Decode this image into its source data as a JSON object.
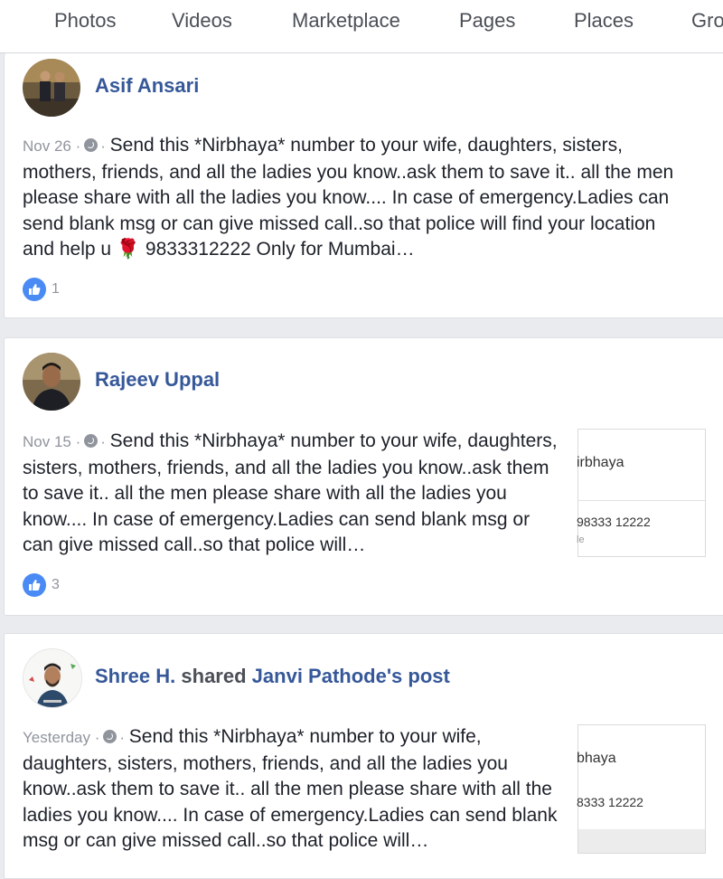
{
  "nav": {
    "tabs": [
      "Photos",
      "Videos",
      "Marketplace",
      "Pages",
      "Places",
      "Gro"
    ]
  },
  "posts": [
    {
      "author": "Asif Ansari",
      "date": "Nov 26",
      "text": "Send this *Nirbhaya* number to your wife, daughters, sisters, mothers, friends, and all the ladies you know..ask them to save it.. all the men please share with all the ladies you know.... In case of emergency.Ladies can send blank msg or can give missed call..so that police will find your location and help u 🌹 9833312222 Only for Mumbai…",
      "likes": "1"
    },
    {
      "author": "Rajeev Uppal",
      "date": "Nov 15",
      "text": "Send this *Nirbhaya* number to your wife, daughters, sisters, mothers, friends, and all the ladies you know..ask them to save it.. all the men please share with all the ladies you know.... In case of emergency.Ladies can send blank msg or can give missed call..so that police will…",
      "likes": "3",
      "thumb": {
        "line1": "irbhaya",
        "line2": "98333 12222",
        "line3": "le"
      }
    },
    {
      "author": "Shree H.",
      "shared_word": "shared",
      "shared_source": "Janvi Pathode's post",
      "date": "Yesterday",
      "text": "Send this *Nirbhaya* number to your wife, daughters, sisters, mothers, friends, and all the ladies you know..ask them to save it.. all the men please share with all the ladies you know.... In case of emergency.Ladies can send blank msg or can give missed call..so that police will…",
      "thumb": {
        "line1": "bhaya",
        "line2": "8333 12222"
      }
    }
  ],
  "icons": {
    "privacy": "globe-icon",
    "like": "like-thumb-icon"
  },
  "colors": {
    "link": "#365899",
    "like_badge": "#4a8af4",
    "meta": "#90949c",
    "background": "#e9ebee"
  }
}
